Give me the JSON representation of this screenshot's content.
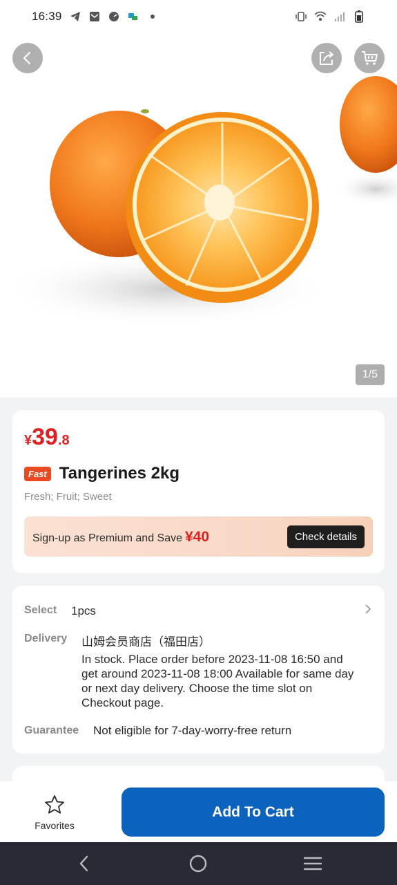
{
  "status_bar": {
    "time": "16:39",
    "icons": [
      "telegram-icon",
      "mail-icon",
      "speedometer-icon",
      "app-icon",
      "dot-icon",
      "vibrate-icon",
      "wifi-icon",
      "signal-icon",
      "battery-icon"
    ]
  },
  "hero": {
    "pager": "1/5",
    "image": "tangerines-photo"
  },
  "product": {
    "price_currency": "¥",
    "price_integer": "39",
    "price_decimal": ".8",
    "badge": "Fast",
    "title": "Tangerines 2kg",
    "tags": "Fresh; Fruit; Sweet",
    "premium_text": "Sign-up as Premium and Save",
    "premium_amount": "¥40",
    "premium_button": "Check details"
  },
  "info": {
    "select_label": "Select",
    "select_value": "1pcs",
    "delivery_label": "Delivery",
    "store": "山姆会员商店（福田店）",
    "delivery_desc": "In stock. Place order before 2023-11-08 16:50 and get around 2023-11-08 18:00 Available for same day or next day delivery. Choose the time slot on Checkout page.",
    "guarantee_label": "Guarantee",
    "guarantee_value": "Not eligible for 7-day-worry-free return"
  },
  "actions": {
    "favorites_label": "Favorites",
    "add_to_cart_label": "Add To Cart"
  },
  "colors": {
    "price_red": "#e02020",
    "primary_blue": "#0b63be",
    "badge_orange": "#ea4a22"
  }
}
